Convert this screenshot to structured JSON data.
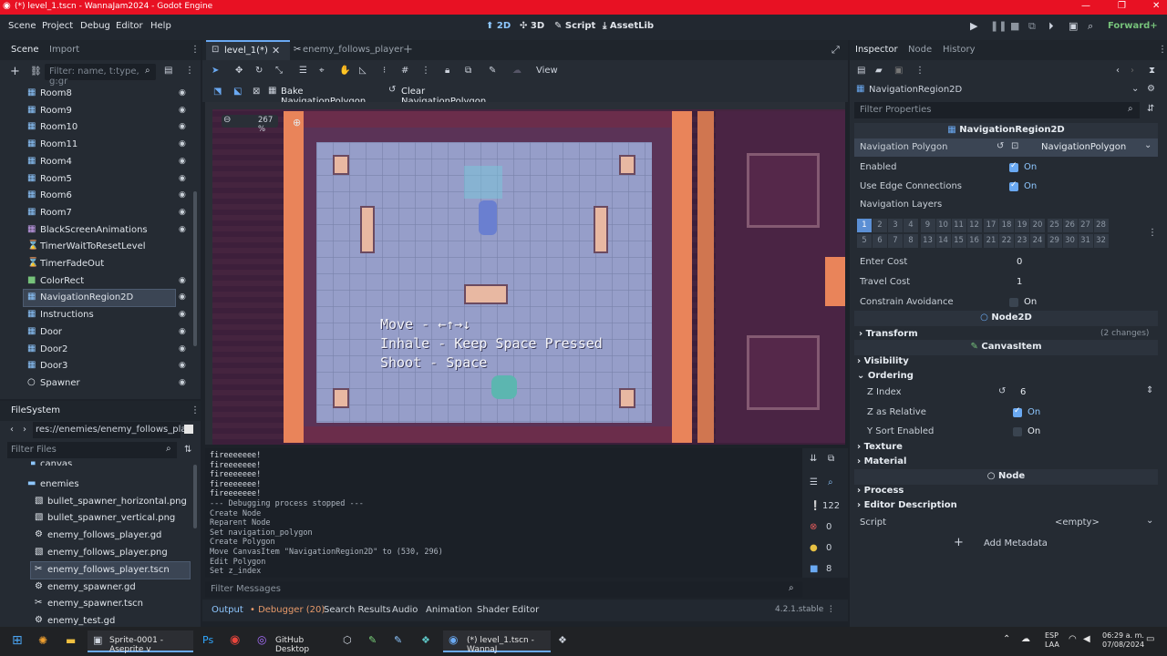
{
  "window": {
    "title": "(*) level_1.tscn - WannaJam2024 - Godot Engine"
  },
  "menu": [
    "Scene",
    "Project",
    "Debug",
    "Editor",
    "Help"
  ],
  "workspaces": [
    "2D",
    "3D",
    "Script",
    "AssetLib"
  ],
  "renderer": "Forward+",
  "scene_dock": {
    "tabs": [
      "Scene",
      "Import"
    ],
    "filter_placeholder": "Filter: name, t:type, g:gr",
    "nodes": [
      {
        "name": "Room8",
        "icon": "node2d-icon"
      },
      {
        "name": "Room9",
        "icon": "node2d-icon"
      },
      {
        "name": "Room10",
        "icon": "node2d-icon"
      },
      {
        "name": "Room11",
        "icon": "node2d-icon"
      },
      {
        "name": "Room4",
        "icon": "node2d-icon"
      },
      {
        "name": "Room5",
        "icon": "node2d-icon"
      },
      {
        "name": "Room6",
        "icon": "node2d-icon"
      },
      {
        "name": "Room7",
        "icon": "node2d-icon"
      },
      {
        "name": "BlackScreenAnimations",
        "icon": "animation-player-icon"
      },
      {
        "name": "TimerWaitToResetLevel",
        "icon": "timer-icon"
      },
      {
        "name": "TimerFadeOut",
        "icon": "timer-icon"
      },
      {
        "name": "ColorRect",
        "icon": "color-rect-icon"
      },
      {
        "name": "NavigationRegion2D",
        "icon": "navigation-region-icon"
      },
      {
        "name": "Instructions",
        "icon": "node2d-icon"
      },
      {
        "name": "Door",
        "icon": "node2d-icon"
      },
      {
        "name": "Door2",
        "icon": "node2d-icon"
      },
      {
        "name": "Door3",
        "icon": "node2d-icon"
      },
      {
        "name": "Spawner",
        "icon": "node-icon"
      }
    ]
  },
  "filesystem": {
    "title": "FileSystem",
    "path": "res://enemies/enemy_follows_play",
    "filter_placeholder": "Filter Files",
    "items": [
      {
        "name": "canvas",
        "indent": 1,
        "icon": "folder-icon"
      },
      {
        "name": "enemies",
        "indent": 1,
        "icon": "folder-icon"
      },
      {
        "name": "bullet_spawner_horizontal.png",
        "indent": 2,
        "icon": "image-icon"
      },
      {
        "name": "bullet_spawner_vertical.png",
        "indent": 2,
        "icon": "image-icon"
      },
      {
        "name": "enemy_follows_player.gd",
        "indent": 2,
        "icon": "gear-icon"
      },
      {
        "name": "enemy_follows_player.png",
        "indent": 2,
        "icon": "image-icon"
      },
      {
        "name": "enemy_follows_player.tscn",
        "indent": 2,
        "icon": "scene-icon"
      },
      {
        "name": "enemy_spawner.gd",
        "indent": 2,
        "icon": "gear-icon"
      },
      {
        "name": "enemy_spawner.tscn",
        "indent": 2,
        "icon": "scene-icon"
      },
      {
        "name": "enemy_test.gd",
        "indent": 2,
        "icon": "gear-icon"
      }
    ]
  },
  "editor_tabs": [
    "level_1(*)",
    "enemy_follows_player"
  ],
  "toolbar": {
    "view": "View",
    "bake": "Bake NavigationPolygon",
    "clear": "Clear NavigationPolygon",
    "zoom": "267 %"
  },
  "game_text": [
    "Move - ←↑→↓",
    "Inhale - Keep Space Pressed",
    "Shoot - Space"
  ],
  "output_lines": [
    "fireeeeeee!",
    "fireeeeeee!",
    "fireeeeeee!",
    "fireeeeeee!",
    "fireeeeeee!",
    "--- Debugging process stopped ---",
    "Create Node",
    "Reparent Node",
    "Set navigation_polygon",
    "Create Polygon",
    "Move CanvasItem \"NavigationRegion2D\" to (530, 296)",
    "Edit Polygon",
    "Set z_index"
  ],
  "output_filter_placeholder": "Filter Messages",
  "output_counts": {
    "messages": "122",
    "errors": "0",
    "warnings": "0",
    "editor": "8"
  },
  "bottom_tabs": [
    "Output",
    "Debugger (20)",
    "Search Results",
    "Audio",
    "Animation",
    "Shader Editor"
  ],
  "version": "4.2.1.stable",
  "inspector": {
    "tabs": [
      "Inspector",
      "Node",
      "History"
    ],
    "node_name": "NavigationRegion2D",
    "filter_placeholder": "Filter Properties",
    "class_header": "NavigationRegion2D",
    "navigation_polygon_label": "Navigation Polygon",
    "navigation_polygon_value": "NavigationPolygon",
    "enabled_label": "Enabled",
    "on": "On",
    "edge_label": "Use Edge Connections",
    "layers_label": "Navigation Layers",
    "layers_row1": [
      "1",
      "2",
      "3",
      "4",
      "9",
      "10",
      "11",
      "12",
      "17",
      "18",
      "19",
      "20",
      "25",
      "26",
      "27",
      "28"
    ],
    "layers_row2": [
      "5",
      "6",
      "7",
      "8",
      "13",
      "14",
      "15",
      "16",
      "21",
      "22",
      "23",
      "24",
      "29",
      "30",
      "31",
      "32"
    ],
    "enter_cost_label": "Enter Cost",
    "enter_cost": "0",
    "travel_cost_label": "Travel Cost",
    "travel_cost": "1",
    "constrain_label": "Constrain Avoidance",
    "node2d": "Node2D",
    "transform": "Transform",
    "changes": "(2 changes)",
    "canvasitem": "CanvasItem",
    "visibility": "Visibility",
    "ordering": "Ordering",
    "z_index_label": "Z Index",
    "z_index": "6",
    "z_rel_label": "Z as Relative",
    "ysort_label": "Y Sort Enabled",
    "texture": "Texture",
    "material": "Material",
    "node": "Node",
    "process": "Process",
    "editor_desc": "Editor Description",
    "script_label": "Script",
    "script_value": "<empty>",
    "add_metadata": "Add Metadata"
  },
  "taskbar": {
    "apps": [
      "Sprite-0001 - Aseprite v",
      "GitHub Desktop",
      "(*) level_1.tscn - WannaJ"
    ],
    "lang": "ESP",
    "lang2": "LAA",
    "time": "06:29 a. m.",
    "date": "07/08/2024"
  },
  "colors": {
    "accent": "#6aa9f2",
    "titlebar": "#e81123",
    "nav_overlay": "#a9c3ef"
  }
}
